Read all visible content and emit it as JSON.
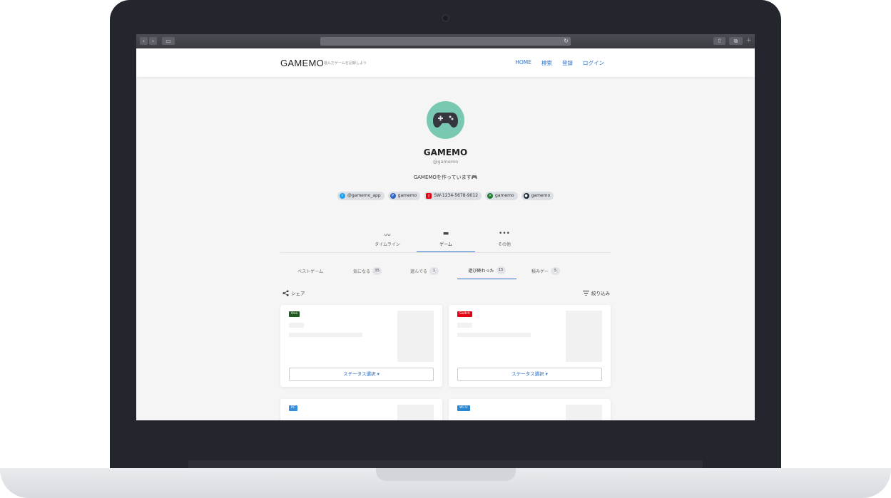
{
  "header": {
    "logo": "GAMEMO",
    "tagline": "遊んだゲームを記録しよう",
    "nav": [
      "HOME",
      "検索",
      "登録",
      "ログイン"
    ]
  },
  "profile": {
    "name": "GAMEMO",
    "handle": "@gamemo",
    "bio": "GAMEMOを作っています🎮",
    "links": [
      {
        "icon": "twitter-icon",
        "label": "@gamemo_app",
        "color": "#1da1f2"
      },
      {
        "icon": "playstation-icon",
        "label": "gamemo",
        "color": "#2f63c4"
      },
      {
        "icon": "nintendo-switch-icon",
        "label": "SW-1234-5678-9012",
        "color": "#e60012"
      },
      {
        "icon": "xbox-icon",
        "label": "gamemo",
        "color": "#1e7d30"
      },
      {
        "icon": "steam-icon",
        "label": "gamemo",
        "color": "#1b2838"
      }
    ]
  },
  "tabs": [
    {
      "icon": "timeline-icon",
      "label": "タイムライン"
    },
    {
      "icon": "gamepad-icon",
      "label": "ゲーム"
    },
    {
      "icon": "more-icon",
      "label": "その他"
    }
  ],
  "subtabs": [
    {
      "label": "ベストゲーム",
      "count": ""
    },
    {
      "label": "気になる",
      "count": "35"
    },
    {
      "label": "遊んでる",
      "count": "1"
    },
    {
      "label": "遊び終わった",
      "count": "15"
    },
    {
      "label": "積みゲー",
      "count": "5"
    }
  ],
  "actions": {
    "share": "シェア",
    "filter": "絞り込み"
  },
  "cards": [
    {
      "platform": "One",
      "platform_color": "#1e5a1e",
      "status": "ステータス選択"
    },
    {
      "platform": "Switch",
      "platform_color": "#e60012",
      "status": "ステータス選択"
    },
    {
      "platform": "PC",
      "platform_color": "#3a8ed8",
      "status": ""
    },
    {
      "platform": "Wii U",
      "platform_color": "#2b86d1",
      "status": ""
    }
  ]
}
